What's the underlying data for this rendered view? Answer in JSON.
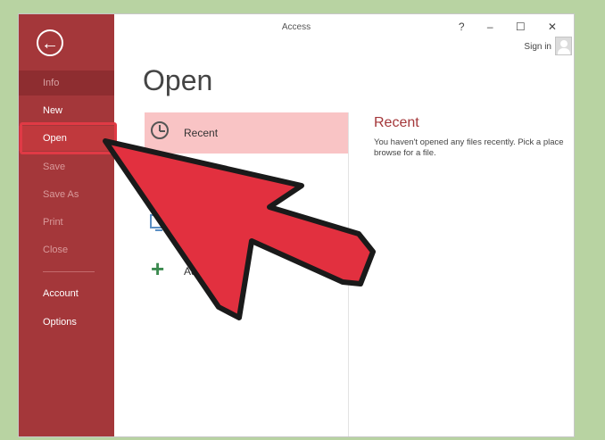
{
  "window": {
    "title": "Access",
    "controls": "? – ☐ ✕",
    "sign_in": "Sign in"
  },
  "sidebar": {
    "back_icon": "back-arrow-icon",
    "items": [
      {
        "label": "Info",
        "state": "selected-dim"
      },
      {
        "label": "New",
        "state": "enabled"
      },
      {
        "label": "Open",
        "state": "active"
      },
      {
        "label": "Save",
        "state": "disabled"
      },
      {
        "label": "Save As",
        "state": "disabled"
      },
      {
        "label": "Print",
        "state": "disabled"
      },
      {
        "label": "Close",
        "state": "disabled"
      },
      {
        "label": "Account",
        "state": "enabled"
      },
      {
        "label": "Options",
        "state": "enabled"
      }
    ]
  },
  "main": {
    "heading": "Open",
    "places": [
      {
        "label": "Recent",
        "icon": "clock-icon",
        "selected": true
      },
      {
        "label": "",
        "icon": "computer-icon",
        "selected": false
      },
      {
        "label": "Add",
        "icon": "plus-icon",
        "selected": false
      }
    ]
  },
  "detail": {
    "title": "Recent",
    "text": "You haven't opened any files recently. Pick a place browse for a file."
  },
  "colors": {
    "accent": "#a4373a",
    "highlight": "#f9c4c5",
    "overlay_arrow": "#e2303f",
    "backdrop": "#b8d3a2"
  }
}
